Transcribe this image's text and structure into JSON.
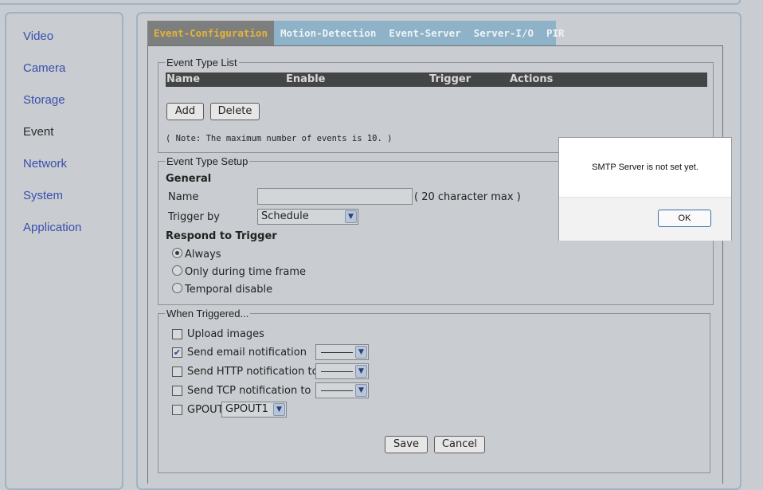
{
  "sidebar": {
    "items": [
      {
        "label": "Video"
      },
      {
        "label": "Camera"
      },
      {
        "label": "Storage"
      },
      {
        "label": "Event"
      },
      {
        "label": "Network"
      },
      {
        "label": "System"
      },
      {
        "label": "Application"
      }
    ],
    "active": "Event"
  },
  "tabs": [
    {
      "label": "Event-Configuration",
      "active": true
    },
    {
      "label": "Motion-Detection"
    },
    {
      "label": "Event-Server"
    },
    {
      "label": "Server-I/O"
    },
    {
      "label": "PIR"
    }
  ],
  "event_type_list": {
    "legend": "Event Type List",
    "columns": [
      "Name",
      "Enable",
      "Trigger",
      "Actions"
    ],
    "add_label": "Add",
    "delete_label": "Delete",
    "note": "( Note: The maximum number of events is 10. )"
  },
  "event_type_setup": {
    "legend": "Event Type Setup",
    "general_heading": "General",
    "name_label": "Name",
    "name_value": "",
    "name_hint": "( 20 character max )",
    "trigger_label": "Trigger by",
    "trigger_value": "Schedule",
    "respond_heading": "Respond to Trigger",
    "options": [
      {
        "label": "Always",
        "selected": true
      },
      {
        "label": "Only during time frame",
        "selected": false
      },
      {
        "label": "Temporal disable",
        "selected": false
      }
    ]
  },
  "when_triggered": {
    "legend": "When Triggered...",
    "upload_label": "Upload images",
    "email_label": "Send email notification",
    "http_label": "Send HTTP notification to",
    "tcp_label": "Send TCP notification to",
    "gpout_label": "GPOUT",
    "gpout_value": "GPOUT1",
    "checked": {
      "upload": false,
      "email": true,
      "http": false,
      "tcp": false,
      "gpout": false
    }
  },
  "actions": {
    "save_label": "Save",
    "cancel_label": "Cancel"
  },
  "dialog": {
    "message": "SMTP Server is not set yet.",
    "ok_label": "OK"
  },
  "icons": {
    "dropdown": "chevron-down-icon",
    "check": "checkmark-icon"
  }
}
